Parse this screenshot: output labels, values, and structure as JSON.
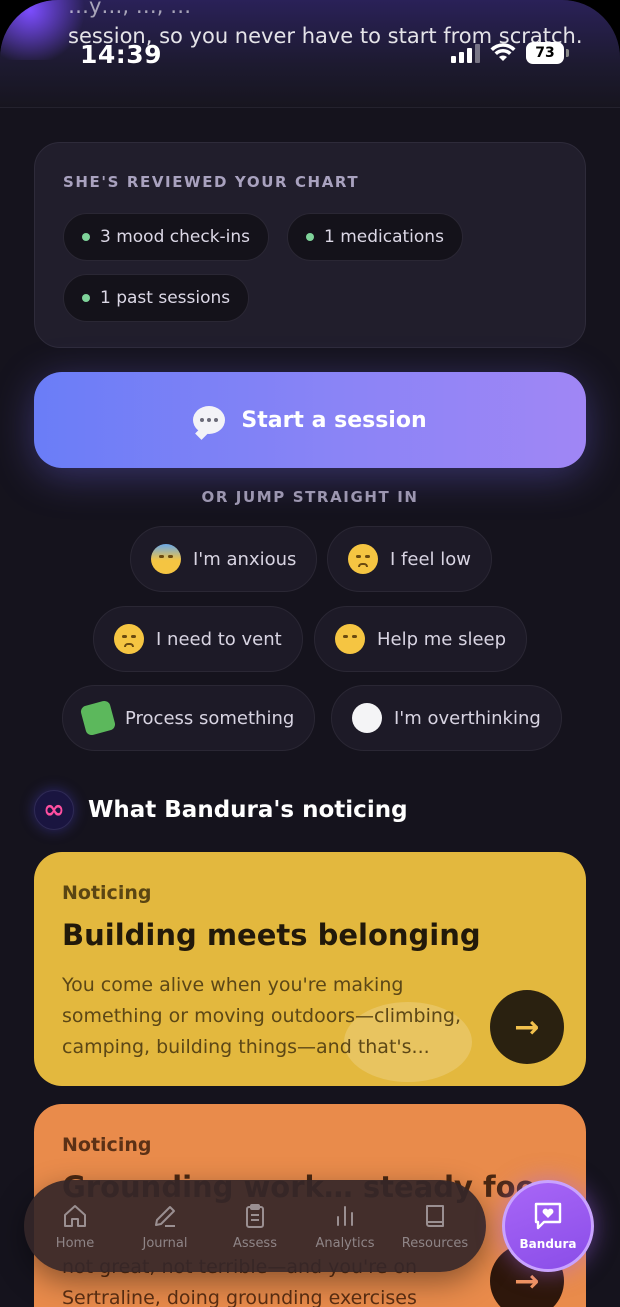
{
  "status_bar": {
    "time": "14:39",
    "battery": "73"
  },
  "scroll_text": {
    "partial_line": "…y…, …, …",
    "line": "session, so you never have to start from scratch."
  },
  "chart_card": {
    "title": "SHE'S REVIEWED YOUR CHART",
    "pills": [
      "3 mood check-ins",
      "1 medications",
      "1 past sessions"
    ]
  },
  "start_session": {
    "label": "Start a session",
    "icon": "speech-bubble-icon"
  },
  "jump": {
    "label": "OR JUMP STRAIGHT IN",
    "chips": [
      {
        "label": "I'm anxious",
        "icon": "anxious-face-icon"
      },
      {
        "label": "I feel low",
        "icon": "disappointed-face-icon"
      },
      {
        "label": "I need to vent",
        "icon": "steam-face-icon"
      },
      {
        "label": "Help me sleep",
        "icon": "sleeping-face-icon"
      },
      {
        "label": "Process something",
        "icon": "puzzle-icon"
      },
      {
        "label": "I'm overthinking",
        "icon": "thought-bubble-icon"
      }
    ]
  },
  "noticing": {
    "title": "What Bandura's noticing",
    "cards": [
      {
        "kicker": "Noticing",
        "title": "Building meets belonging",
        "body": "You come alive when you're making something or moving outdoors—climbing, camping, building things—and that's...",
        "color": "#e3b83e"
      },
      {
        "kicker": "Noticing",
        "title": "Grounding work… steady foo",
        "body": "not great, not terrible—and you're on Sertraline, doing grounding exercises whe...",
        "color": "#e98b4b"
      }
    ]
  },
  "tabbar": {
    "tabs": [
      {
        "label": "Home",
        "icon": "home-icon"
      },
      {
        "label": "Journal",
        "icon": "pen-icon"
      },
      {
        "label": "Assess",
        "icon": "clipboard-icon"
      },
      {
        "label": "Analytics",
        "icon": "bar-chart-icon"
      },
      {
        "label": "Resources",
        "icon": "book-icon"
      }
    ],
    "fab_label": "Bandura"
  },
  "colors": {
    "accent": "#8a84f6",
    "fab": "#a866f7",
    "pill_dot": "#7fd39a"
  }
}
